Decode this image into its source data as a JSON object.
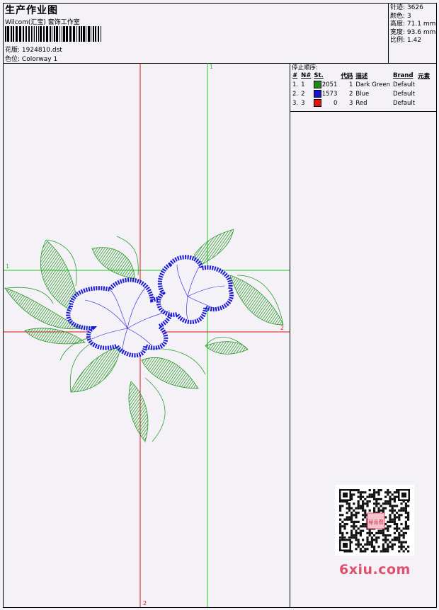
{
  "header": {
    "title": "生产作业图",
    "company": "Wilcom(汇宝) 套饰工作室",
    "file_label": "花版:",
    "file_name": "1924810.dst",
    "colorway_label": "色位:",
    "colorway": "Colorway 1"
  },
  "stats": {
    "stitches_label": "针迹:",
    "stitches": "3626",
    "colors_label": "颜色:",
    "colors": "3",
    "height_label": "高度:",
    "height": "71.1 mm",
    "width_label": "宽度:",
    "width": "93.6 mm",
    "scale_label": "比例:",
    "scale": "1.42"
  },
  "stop_sequence": {
    "heading": "停止顺序:",
    "columns": [
      "#",
      "N#",
      "St.",
      "代码",
      "描述",
      "Brand",
      "元素"
    ],
    "rows": [
      {
        "idx": "1.",
        "n": "1",
        "color": "#1e8a1e",
        "st": "2051",
        "code": "1",
        "desc": "Dark Green",
        "brand": "Default"
      },
      {
        "idx": "2.",
        "n": "2",
        "color": "#1414d2",
        "st": "1573",
        "code": "2",
        "desc": "Blue",
        "brand": "Default"
      },
      {
        "idx": "3.",
        "n": "3",
        "color": "#e01414",
        "st": "0",
        "code": "3",
        "desc": "Red",
        "brand": "Default"
      }
    ]
  },
  "axes": {
    "green_v": "1",
    "green_h": "1",
    "red_h": "2",
    "red_v": "2"
  },
  "watermark": "6xiu.com",
  "qr_stamp": "秘品图",
  "colors": {
    "green_guide": "#22cc22",
    "red_guide": "#dd1111",
    "leaf": "#2a9a2a",
    "petal": "#1a1ad8"
  }
}
